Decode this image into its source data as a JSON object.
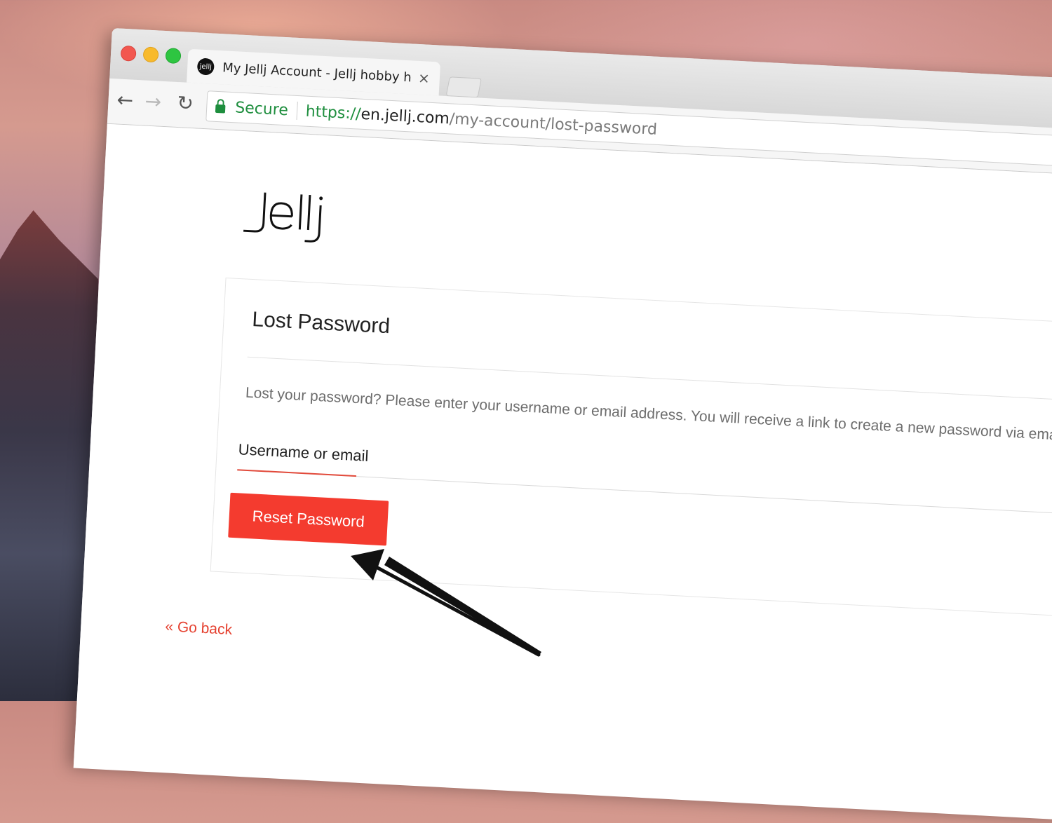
{
  "browser": {
    "tab_title": "My Jellj Account - Jellj hobby h",
    "favicon_text": "jellj",
    "close_glyph": "×",
    "nav": {
      "back_glyph": "←",
      "forward_glyph": "→",
      "reload_glyph": "↻"
    },
    "security_label": "Secure",
    "url": {
      "scheme": "https://",
      "host": "en.jellj.com",
      "path": "/my-account/lost-password"
    }
  },
  "page": {
    "logo_text": "jellj",
    "title": "Lost Password",
    "description": "Lost your password? Please enter your username or email address. You will receive a link to create a new password via email.",
    "field_label": "Username or email",
    "reset_button": "Reset Password",
    "go_back": "« Go back"
  },
  "colors": {
    "accent": "#f43b2f",
    "link": "#e5402f",
    "secure": "#1e8e3e"
  },
  "icons": [
    "lock-icon",
    "back-arrow-icon",
    "forward-arrow-icon",
    "reload-icon",
    "close-icon",
    "annotation-arrow-icon"
  ]
}
